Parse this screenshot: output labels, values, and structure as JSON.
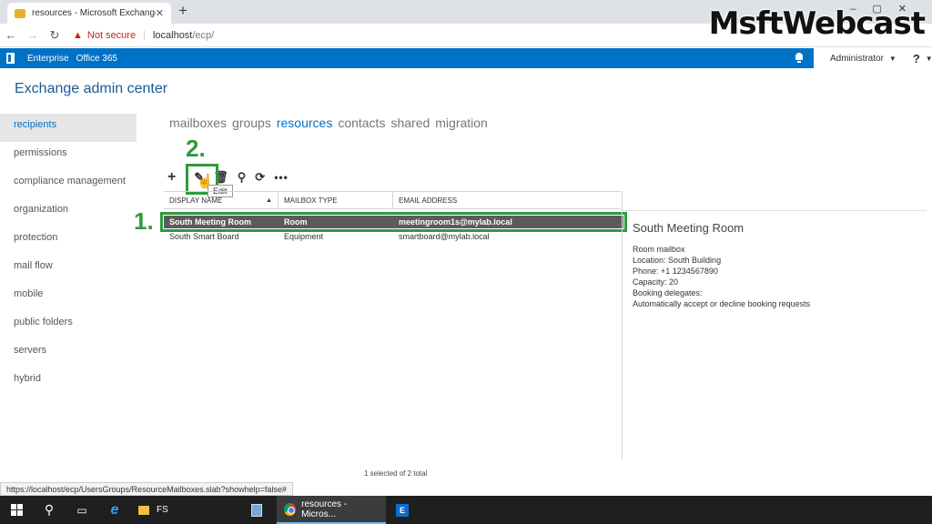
{
  "browser": {
    "tab_title": "resources - Microsoft Exchange",
    "tab_close": "✕",
    "new_tab": "+",
    "not_secure": "Not secure",
    "url_host": "localhost",
    "url_path": "/ecp/"
  },
  "watermark": "MsftWebcast",
  "o365": {
    "enterprise": "Enterprise",
    "office365": "Office 365",
    "user": "Administrator",
    "help": "?"
  },
  "eac": {
    "title": "Exchange admin center",
    "nav": [
      "recipients",
      "permissions",
      "compliance management",
      "organization",
      "protection",
      "mail flow",
      "mobile",
      "public folders",
      "servers",
      "hybrid"
    ],
    "subtabs": [
      "mailboxes",
      "groups",
      "resources",
      "contacts",
      "shared",
      "migration"
    ],
    "tooltip": "Edit",
    "columns": [
      "DISPLAY NAME",
      "MAILBOX TYPE",
      "EMAIL ADDRESS"
    ],
    "rows": [
      {
        "name": "South Meeting Room",
        "type": "Room",
        "email": "meetingroom1s@mylab.local"
      },
      {
        "name": "South Smart Board",
        "type": "Equipment",
        "email": "smartboard@mylab.local"
      }
    ],
    "details": {
      "title": "South Meeting Room",
      "lines": [
        "Room mailbox",
        "Location: South Building",
        "Phone: +1 1234567890",
        "Capacity: 20",
        "Booking delegates:",
        "Automatically accept or decline booking requests"
      ]
    },
    "selection_status": "1 selected of 2 total"
  },
  "annotations": {
    "step1": "1.",
    "step2": "2."
  },
  "status_url": "https://localhost/ecp/UsersGroups/ResourceMailboxes.slab?showhelp=false#",
  "taskbar": {
    "explorer_label": "FS",
    "chrome_label": "resources - Micros..."
  }
}
